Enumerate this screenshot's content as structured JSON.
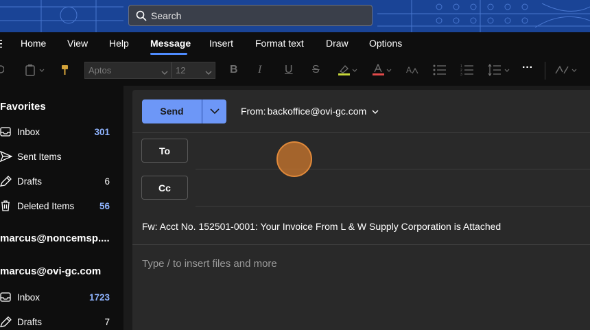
{
  "search": {
    "label": "Search"
  },
  "menu": {
    "collapse_icon": "menu-icon",
    "items": [
      "Home",
      "View",
      "Help",
      "Message",
      "Insert",
      "Format text",
      "Draw",
      "Options"
    ],
    "active": "Message"
  },
  "toolbar": {
    "font": "Aptos",
    "size": "12",
    "icons": [
      "undo-icon",
      "paste-icon",
      "format-painter-icon",
      "bold-icon",
      "italic-icon",
      "underline-icon",
      "strikethrough-icon",
      "highlight-icon",
      "font-color-icon",
      "styles-icon",
      "bullets-icon",
      "numbering-icon",
      "line-spacing-icon",
      "more-icon",
      "editor-icon"
    ],
    "highlight_color": "#c7d73a",
    "font_color": "#e24a4a"
  },
  "sidebar": {
    "favorites": {
      "title": "Favorites",
      "items": [
        {
          "label": "Inbox",
          "count": "301",
          "icon": "inbox-icon"
        },
        {
          "label": "Sent Items",
          "count": "",
          "icon": "send-icon"
        },
        {
          "label": "Drafts",
          "count": "6",
          "icon": "drafts-icon"
        },
        {
          "label": "Deleted Items",
          "count": "56",
          "icon": "trash-icon"
        }
      ]
    },
    "accounts": [
      {
        "name": "marcus@noncemsp...."
      },
      {
        "name": "marcus@ovi-gc.com",
        "items": [
          {
            "label": "Inbox",
            "count": "1723",
            "icon": "inbox-icon"
          },
          {
            "label": "Drafts",
            "count": "7",
            "icon": "drafts-icon"
          }
        ]
      }
    ]
  },
  "compose": {
    "send_label": "Send",
    "from_label": "From:",
    "from_address": "backoffice@ovi-gc.com",
    "to_label": "To",
    "cc_label": "Cc",
    "subject": "Fw: Acct No. 152501-0001: Your Invoice From L & W Supply Corporation is Attached",
    "body_placeholder": "Type / to insert files and more"
  },
  "colors": {
    "accent": "#6d97f7",
    "background": "#1b1b1b",
    "panel": "#292929",
    "count_blue": "#8fb4ff"
  }
}
